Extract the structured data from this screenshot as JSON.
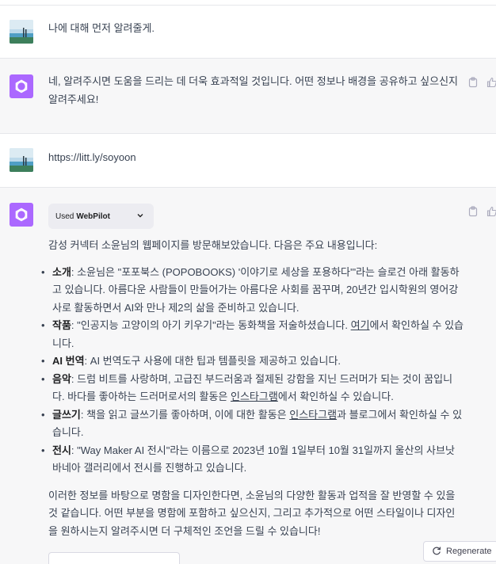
{
  "messages": {
    "user1": {
      "text": "나에 대해 먼저 알려줄게."
    },
    "bot1": {
      "text": "네, 알려주시면 도움을 드리는 데 더욱 효과적일 것입니다. 어떤 정보나 배경을 공유하고 싶으신지 알려주세요!"
    },
    "user2": {
      "text": "https://litt.ly/soyoon"
    },
    "bot2": {
      "plugin": {
        "used_label": "Used",
        "name": "WebPilot"
      },
      "intro": "감성 커넥터 소윤님의 웹페이지를 방문해보았습니다. 다음은 주요 내용입니다:",
      "items": [
        {
          "label": "소개",
          "text": ": 소윤님은 \"포포북스 (POPOBOOKS) '이야기로 세상을 포용하다'\"라는 슬로건 아래 활동하고 있습니다. 아름다운 사람들이 만들어가는 아름다운 사회를 꿈꾸며, 20년간 입시학원의 영어강사로 활동하면서 AI와 만나 제2의 삶을 준비하고 있습니다."
        },
        {
          "label": "작품",
          "text_before": ": \"인공지능 고양이의 아기 키우기\"라는 동화책을 저술하셨습니다. ",
          "link": "여기",
          "text_after": "에서 확인하실 수 있습니다."
        },
        {
          "label": "AI 번역",
          "text": ": AI 번역도구 사용에 대한 팁과 템플릿을 제공하고 있습니다."
        },
        {
          "label": "음악",
          "text_before": ": 드럼 비트를 사랑하며, 고급진 부드러움과 절제된 강함을 지닌 드러머가 되는 것이 꿈입니다. 바다를 좋아하는 드러머로서의 활동은 ",
          "link": "인스타그램",
          "text_after": "에서 확인하실 수 있습니다."
        },
        {
          "label": "글쓰기",
          "text_before": ": 책을 읽고 글쓰기를 좋아하며, 이에 대한 활동은 ",
          "link": "인스타그램",
          "text_after": "과 블로그에서 확인하실 수 있습니다."
        },
        {
          "label": "전시",
          "text": ": \"Way Maker AI 전시\"라는 이름으로 2023년 10월 1일부터 10월 31일까지 울산의 사브낫 바네아 갤러리에서 전시를 진행하고 있습니다."
        }
      ],
      "outro": "이러한 정보를 바탕으로 명함을 디자인한다면, 소윤님의 다양한 활동과 업적을 잘 반영할 수 있을 것 같습니다. 어떤 부분을 명함에 포함하고 싶으신지, 그리고 추가적으로 어떤 스타일이나 디자인을 원하시는지 알려주시면 더 구체적인 조언을 드릴 수 있습니다!"
    }
  },
  "regenerate_label": "Regenerate",
  "colors": {
    "bot_avatar": "#ab68ff",
    "bot_bg": "#f7f7f8",
    "border": "#e5e7eb"
  },
  "icons": {
    "copy": "clipboard-icon",
    "like": "thumbs-up-icon",
    "regen": "refresh-icon",
    "bot": "openai-logo-icon",
    "user": "landscape-avatar-icon"
  }
}
